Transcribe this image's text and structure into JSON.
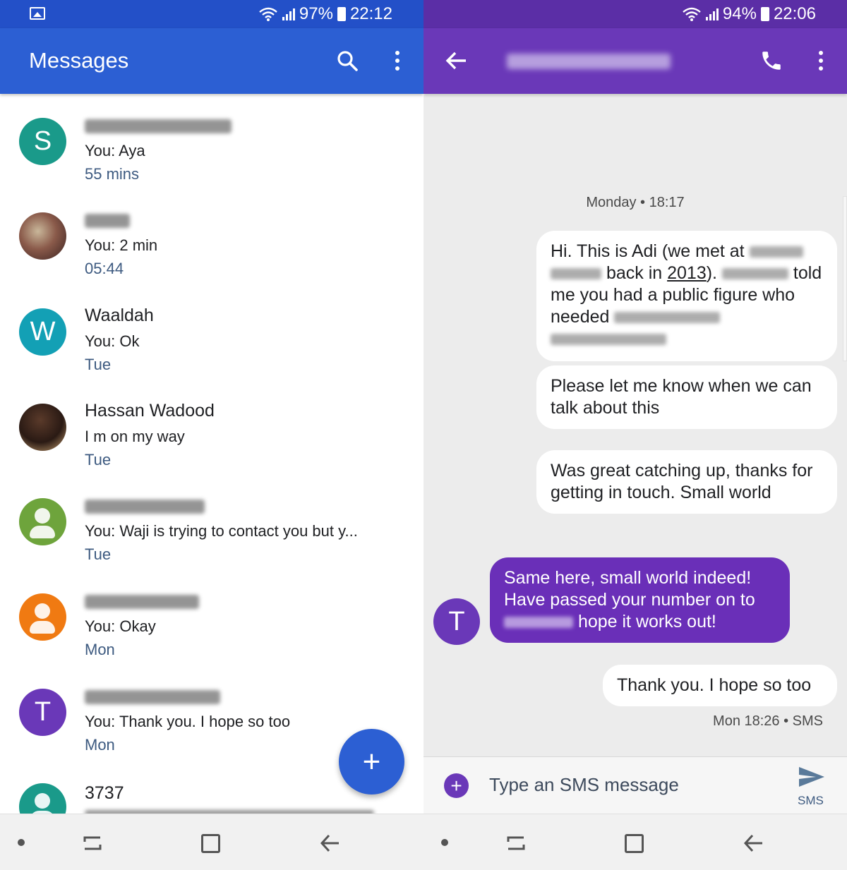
{
  "left": {
    "status": {
      "battery": "97%",
      "time": "22:12"
    },
    "app_title": "Messages",
    "conversations": [
      {
        "name": "",
        "snippet": "You: Aya",
        "time": "55 mins",
        "avatar_letter": "S",
        "avatar_color": "#1a9a8a"
      },
      {
        "name": "",
        "snippet": "You: 2 min",
        "time": "05:44",
        "avatar_letter": "",
        "avatar_color": "#8a5a4a"
      },
      {
        "name": "Waaldah",
        "snippet": "You: Ok",
        "time": "Tue",
        "avatar_letter": "W",
        "avatar_color": "#13a0b5"
      },
      {
        "name": "Hassan Wadood",
        "snippet": "I m on my way",
        "time": "Tue",
        "avatar_letter": "",
        "avatar_color": "#3a2a22"
      },
      {
        "name": "",
        "snippet": "You: Waji is trying to contact you but y...",
        "time": "Tue",
        "avatar_letter": "",
        "avatar_color": "#6ea43c"
      },
      {
        "name": "",
        "snippet": "You: Okay",
        "time": "Mon",
        "avatar_letter": "",
        "avatar_color": "#f07a12"
      },
      {
        "name": "",
        "snippet": "You: Thank you. I hope so too",
        "time": "Mon",
        "avatar_letter": "T",
        "avatar_color": "#6a38b8"
      },
      {
        "name": "3737",
        "snippet": "",
        "time": "",
        "avatar_letter": "",
        "avatar_color": "#1a9a8a"
      }
    ],
    "fab_label": "+"
  },
  "right": {
    "status": {
      "battery": "94%",
      "time": "22:06"
    },
    "date_label": "Monday • 18:17",
    "messages": [
      {
        "part1": "Hi. This is Adi (we met at ",
        "part2": " back in ",
        "year": "2013",
        "part3": "). ",
        "part4": " told me you had a public figure who needed "
      },
      {
        "text": "Please let me know when we can talk about this"
      },
      {
        "text": "Was great catching up, thanks for getting in touch. Small world"
      },
      {
        "line1": "Same here, small world indeed!",
        "line2": "Have passed your number on to",
        "line3": " hope it works out!"
      },
      {
        "text": "Thank you. I hope so too"
      }
    ],
    "incoming_avatar_letter": "T",
    "meta": "Mon 18:26 • SMS",
    "compose_placeholder": "Type an SMS message",
    "send_label": "SMS"
  },
  "colors": {
    "left_appbar": "#2c5fd3",
    "right_appbar": "#6a38b8",
    "incoming_bubble": "#6a2fb8"
  },
  "icons": [
    "search-icon",
    "more-vert-icon",
    "back-arrow-icon",
    "phone-icon",
    "send-icon",
    "add-icon"
  ]
}
